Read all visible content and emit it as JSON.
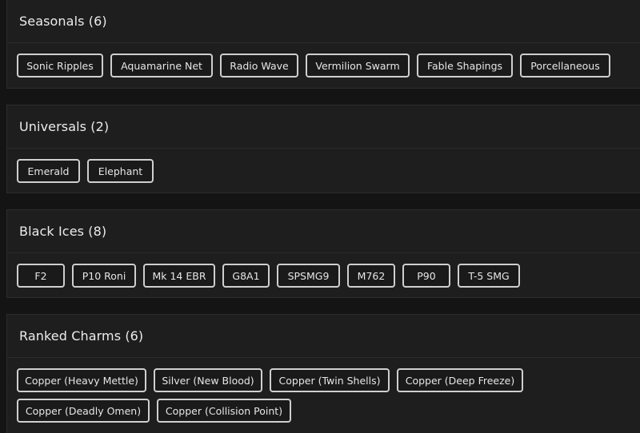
{
  "sections": [
    {
      "title": "Seasonals (6)",
      "items": [
        "Sonic Ripples",
        "Aquamarine Net",
        "Radio Wave",
        "Vermilion Swarm",
        "Fable Shapings",
        "Porcellaneous"
      ]
    },
    {
      "title": "Universals (2)",
      "items": [
        "Emerald",
        "Elephant"
      ]
    },
    {
      "title": "Black Ices (8)",
      "items": [
        "F2",
        "P10 Roni",
        "Mk 14 EBR",
        "G8A1",
        "SPSMG9",
        "M762",
        "P90",
        "T-5 SMG"
      ]
    },
    {
      "title": "Ranked Charms (6)",
      "items": [
        "Copper (Heavy Mettle)",
        "Silver (New Blood)",
        "Copper (Twin Shells)",
        "Copper (Deep Freeze)",
        "Copper (Deadly Omen)",
        "Copper (Collision Point)"
      ]
    }
  ]
}
